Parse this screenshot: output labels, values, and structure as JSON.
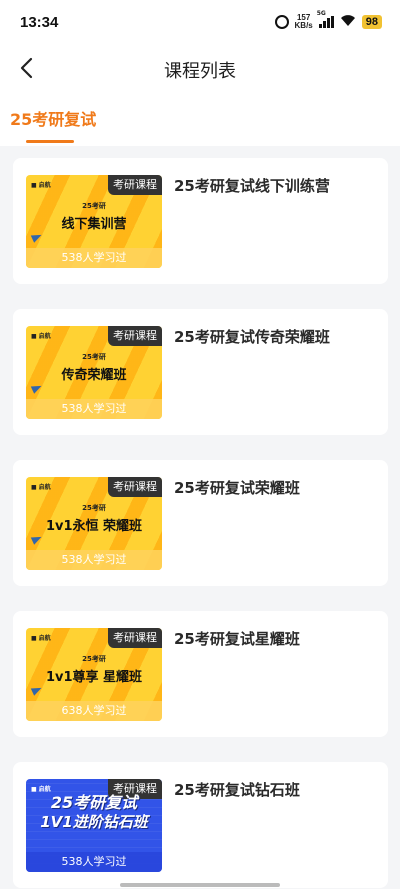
{
  "status_bar": {
    "time": "13:34",
    "net_speed_value": "157",
    "net_speed_unit": "KB/s",
    "network_tag": "5G",
    "battery": "98"
  },
  "nav": {
    "title": "课程列表",
    "back_icon": "chevron-left-icon"
  },
  "tabs": [
    {
      "label": "25考研复试",
      "active": true
    }
  ],
  "courses": [
    {
      "name": "25考研复试线下训练营",
      "badge": "考研课程",
      "thumb_sub": "25考研",
      "thumb_title": "线下集训营",
      "learners": "538人学习过"
    },
    {
      "name": "25考研复试传奇荣耀班",
      "badge": "考研课程",
      "thumb_sub": "25考研",
      "thumb_title": "传奇荣耀班",
      "learners": "538人学习过"
    },
    {
      "name": "25考研复试荣耀班",
      "badge": "考研课程",
      "thumb_sub": "25考研",
      "thumb_title": "1v1永恒 荣耀班",
      "learners": "538人学习过"
    },
    {
      "name": "25考研复试星耀班",
      "badge": "考研课程",
      "thumb_sub": "25考研",
      "thumb_title": "1v1尊享 星耀班",
      "learners": "638人学习过"
    },
    {
      "name": "25考研复试钻石班",
      "badge": "考研课程",
      "thumb_sub": "25考研复试",
      "thumb_title": "1V1进阶钻石班",
      "learners": "538人学习过"
    }
  ],
  "colors": {
    "accent": "#f07a1a",
    "thumb_yellow": "#ffd233",
    "thumb_blue": "#3254e8"
  }
}
